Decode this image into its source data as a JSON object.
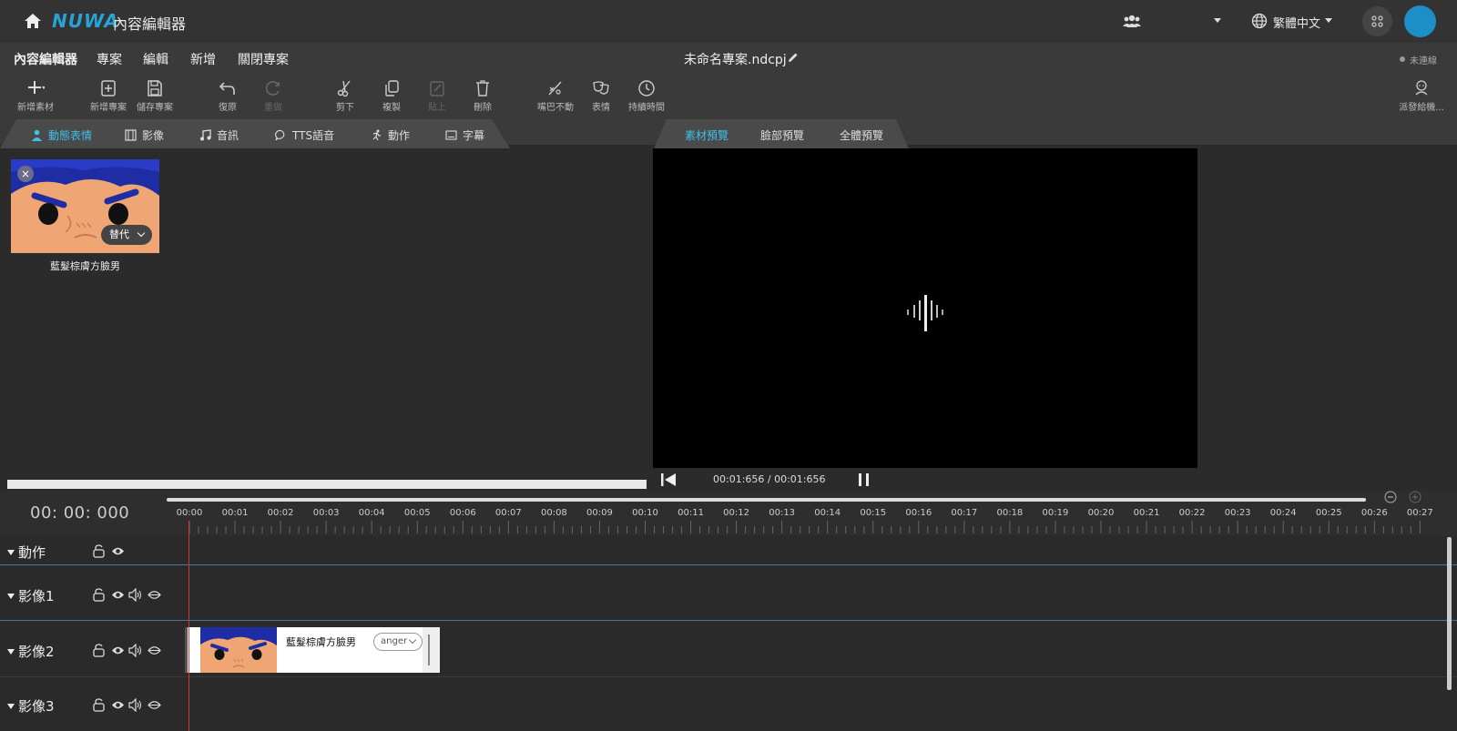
{
  "topbar": {
    "logo": "NUWA",
    "app_title": "內容編輯器",
    "language": "繁體中文"
  },
  "menu": {
    "items": [
      "內容編輯器",
      "專案",
      "編輯",
      "新增",
      "關閉專案"
    ],
    "project_name": "未命名專案.ndcpj",
    "connection_status": "未連線"
  },
  "toolbar": {
    "add_asset": "新增素材",
    "new_project": "新增專案",
    "save_project": "儲存專案",
    "undo": "復原",
    "redo": "重做",
    "cut": "剪下",
    "copy": "複製",
    "paste": "貼上",
    "delete": "刪除",
    "mouth_still": "嘴巴不動",
    "expression": "表情",
    "duration": "持續時間",
    "dispatch": "派發給機..."
  },
  "asset_tabs": [
    "動態表情",
    "影像",
    "音訊",
    "TTS語音",
    "動作",
    "字幕"
  ],
  "preview_tabs": [
    "素材預覽",
    "臉部預覽",
    "全體預覽"
  ],
  "asset": {
    "name": "藍髮棕膚方臉男",
    "dropdown": "替代"
  },
  "player": {
    "time": "00:01:656 / 00:01:656"
  },
  "timeline": {
    "current_time": "00: 00: 000",
    "ticks": [
      "00:00",
      "00:01",
      "00:02",
      "00:03",
      "00:04",
      "00:05",
      "00:06",
      "00:07",
      "00:08",
      "00:09",
      "00:10",
      "00:11",
      "00:12",
      "00:13",
      "00:14",
      "00:15",
      "00:16",
      "00:17",
      "00:18",
      "00:19",
      "00:20",
      "00:21",
      "00:22",
      "00:23",
      "00:24",
      "00:25",
      "00:26",
      "00:27"
    ],
    "tracks": [
      "動作",
      "影像1",
      "影像2",
      "影像3"
    ],
    "clip": {
      "name": "藍髮棕膚方臉男",
      "emotion": "anger"
    }
  },
  "colors": {
    "accent": "#3ec1e8",
    "brand": "#27a3d6",
    "playhead": "#dd3333"
  }
}
